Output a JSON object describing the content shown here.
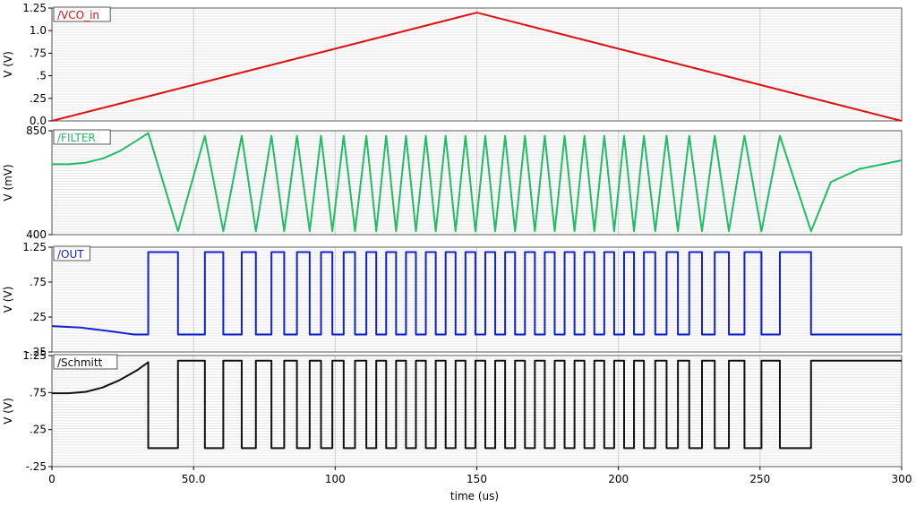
{
  "chart_data": {
    "type": "line",
    "xlabel": "time (us)",
    "xlim": [
      0,
      300
    ],
    "x_ticks": [
      0,
      50,
      100,
      150,
      200,
      250,
      300
    ],
    "x_tick_labels": [
      "0",
      "50.0",
      "100",
      "150",
      "200",
      "250",
      "300"
    ],
    "grid": true,
    "panels": [
      {
        "name": "/VCO_in",
        "color": "#dd1111",
        "ylabel": "V (V)",
        "ylim": [
          0,
          1.25
        ],
        "y_ticks": [
          0,
          0.25,
          0.5,
          0.75,
          1.0,
          1.25
        ],
        "y_tick_labels": [
          "0.0",
          ".25",
          ".5",
          ".75",
          "1.0",
          "1.25"
        ],
        "x": [
          0,
          150,
          300
        ],
        "y": [
          0,
          1.2,
          0
        ]
      },
      {
        "name": "/FILTER",
        "color": "#22bb66",
        "ylabel": "V (mV)",
        "ylim": [
          400,
          850
        ],
        "y_ticks": [
          400,
          850
        ],
        "y_tick_labels": [
          "400",
          "850"
        ],
        "x": [
          0,
          6,
          12,
          18,
          24,
          30,
          34,
          44.5,
          54,
          60.5,
          67,
          72,
          77.5,
          82,
          86.5,
          91,
          95,
          99,
          103,
          107,
          111,
          114.5,
          118,
          121.5,
          125,
          128.5,
          132,
          135.5,
          139,
          142.5,
          146,
          149.5,
          153,
          156.5,
          160,
          163.5,
          167,
          170.5,
          174,
          177.5,
          181,
          184.5,
          188,
          191.5,
          195,
          198.5,
          202,
          205.5,
          209,
          213,
          217,
          221,
          225,
          229.5,
          234,
          239,
          244.5,
          250.5,
          257,
          268,
          275,
          285,
          300
        ],
        "y": [
          705,
          705,
          712,
          730,
          762,
          808,
          840,
          415,
          828,
          415,
          828,
          415,
          828,
          415,
          828,
          415,
          828,
          415,
          828,
          415,
          828,
          415,
          828,
          415,
          828,
          415,
          828,
          415,
          828,
          415,
          828,
          415,
          828,
          415,
          828,
          415,
          828,
          415,
          828,
          415,
          828,
          415,
          828,
          415,
          828,
          415,
          828,
          415,
          828,
          415,
          828,
          415,
          828,
          415,
          828,
          415,
          828,
          415,
          828,
          415,
          628,
          684,
          722,
          728
        ]
      },
      {
        "name": "/OUT",
        "color": "#1122cc",
        "ylabel": "V (V)",
        "ylim": [
          -0.25,
          1.25
        ],
        "y_ticks": [
          -0.25,
          0.25,
          0.75,
          1.25
        ],
        "y_tick_labels": [
          "-.25",
          ".25",
          ".75",
          "1.25"
        ],
        "x": [
          0,
          10,
          20,
          29,
          29,
          34,
          34,
          44.5,
          44.5,
          54,
          54,
          60.5,
          60.5,
          67,
          67,
          72,
          72,
          77.5,
          77.5,
          82,
          82,
          86.5,
          86.5,
          91,
          91,
          95,
          95,
          99,
          99,
          103,
          103,
          107,
          107,
          111,
          111,
          114.5,
          114.5,
          118,
          118,
          121.5,
          121.5,
          125,
          125,
          128.5,
          128.5,
          132,
          132,
          135.5,
          135.5,
          139,
          139,
          142.5,
          142.5,
          146,
          146,
          149.5,
          149.5,
          153,
          153,
          156.5,
          156.5,
          160,
          160,
          163.5,
          163.5,
          167,
          167,
          170.5,
          170.5,
          174,
          174,
          177.5,
          177.5,
          181,
          181,
          184.5,
          184.5,
          188,
          188,
          191.5,
          191.5,
          195,
          195,
          198.5,
          198.5,
          202,
          202,
          205.5,
          205.5,
          209,
          209,
          213,
          213,
          217,
          217,
          221,
          221,
          225,
          225,
          229.5,
          229.5,
          234,
          234,
          239,
          239,
          244.5,
          244.5,
          250.5,
          250.5,
          257,
          257,
          268,
          268,
          300
        ],
        "y": [
          0.12,
          0.1,
          0.05,
          0.0,
          0.0,
          0.0,
          1.18,
          1.18,
          0.0,
          0.0,
          1.18,
          1.18,
          0.0,
          0.0,
          1.18,
          1.18,
          0.0,
          0.0,
          1.18,
          1.18,
          0.0,
          0.0,
          1.18,
          1.18,
          0.0,
          0.0,
          1.18,
          1.18,
          0.0,
          0.0,
          1.18,
          1.18,
          0.0,
          0.0,
          1.18,
          1.18,
          0.0,
          0.0,
          1.18,
          1.18,
          0.0,
          0.0,
          1.18,
          1.18,
          0.0,
          0.0,
          1.18,
          1.18,
          0.0,
          0.0,
          1.18,
          1.18,
          0.0,
          0.0,
          1.18,
          1.18,
          0.0,
          0.0,
          1.18,
          1.18,
          0.0,
          0.0,
          1.18,
          1.18,
          0.0,
          0.0,
          1.18,
          1.18,
          0.0,
          0.0,
          1.18,
          1.18,
          0.0,
          0.0,
          1.18,
          1.18,
          0.0,
          0.0,
          1.18,
          1.18,
          0.0,
          0.0,
          1.18,
          1.18,
          0.0,
          0.0,
          1.18,
          1.18,
          0.0,
          0.0,
          1.18,
          1.18,
          0.0,
          0.0,
          1.18,
          1.18,
          0.0,
          0.0,
          1.18,
          1.18,
          0.0,
          0.0,
          1.18,
          1.18,
          0.0,
          0.0,
          1.18,
          1.18,
          0.0,
          0.0,
          1.18,
          1.18,
          0.0,
          0.0
        ]
      },
      {
        "name": "/Schmitt",
        "color": "#111111",
        "ylabel": "V (V)",
        "ylim": [
          -0.25,
          1.25
        ],
        "y_ticks": [
          -0.25,
          0.25,
          0.75,
          1.25
        ],
        "y_tick_labels": [
          "-.25",
          ".25",
          ".75",
          "1.25"
        ],
        "x": [
          0,
          6,
          12,
          18,
          24,
          30,
          34,
          34,
          44.5,
          44.5,
          54,
          54,
          60.5,
          60.5,
          67,
          67,
          72,
          72,
          77.5,
          77.5,
          82,
          82,
          86.5,
          86.5,
          91,
          91,
          95,
          95,
          99,
          99,
          103,
          103,
          107,
          107,
          111,
          111,
          114.5,
          114.5,
          118,
          118,
          121.5,
          121.5,
          125,
          125,
          128.5,
          128.5,
          132,
          132,
          135.5,
          135.5,
          139,
          139,
          142.5,
          142.5,
          146,
          146,
          149.5,
          149.5,
          153,
          153,
          156.5,
          156.5,
          160,
          160,
          163.5,
          163.5,
          167,
          167,
          170.5,
          170.5,
          174,
          174,
          177.5,
          177.5,
          181,
          181,
          184.5,
          184.5,
          188,
          188,
          191.5,
          191.5,
          195,
          195,
          198.5,
          198.5,
          202,
          202,
          205.5,
          205.5,
          209,
          209,
          213,
          213,
          217,
          217,
          221,
          221,
          225,
          225,
          229.5,
          229.5,
          234,
          234,
          239,
          239,
          244.5,
          244.5,
          250.5,
          250.5,
          257,
          257,
          268,
          268,
          300
        ],
        "y": [
          0.74,
          0.74,
          0.76,
          0.82,
          0.92,
          1.05,
          1.16,
          0.0,
          0.0,
          1.18,
          1.18,
          0.0,
          0.0,
          1.18,
          1.18,
          0.0,
          0.0,
          1.18,
          1.18,
          0.0,
          0.0,
          1.18,
          1.18,
          0.0,
          0.0,
          1.18,
          1.18,
          0.0,
          0.0,
          1.18,
          1.18,
          0.0,
          0.0,
          1.18,
          1.18,
          0.0,
          0.0,
          1.18,
          1.18,
          0.0,
          0.0,
          1.18,
          1.18,
          0.0,
          0.0,
          1.18,
          1.18,
          0.0,
          0.0,
          1.18,
          1.18,
          0.0,
          0.0,
          1.18,
          1.18,
          0.0,
          0.0,
          1.18,
          1.18,
          0.0,
          0.0,
          1.18,
          1.18,
          0.0,
          0.0,
          1.18,
          1.18,
          0.0,
          0.0,
          1.18,
          1.18,
          0.0,
          0.0,
          1.18,
          1.18,
          0.0,
          0.0,
          1.18,
          1.18,
          0.0,
          0.0,
          1.18,
          1.18,
          0.0,
          0.0,
          1.18,
          1.18,
          0.0,
          0.0,
          1.18,
          1.18,
          0.0,
          0.0,
          1.18,
          1.18,
          0.0,
          0.0,
          1.18,
          1.18,
          0.0,
          0.0,
          1.18,
          1.18,
          0.0,
          0.0,
          1.18,
          1.18,
          0.0,
          0.0,
          1.18,
          1.18,
          0.0,
          0.0,
          1.18,
          1.18
        ]
      }
    ]
  }
}
